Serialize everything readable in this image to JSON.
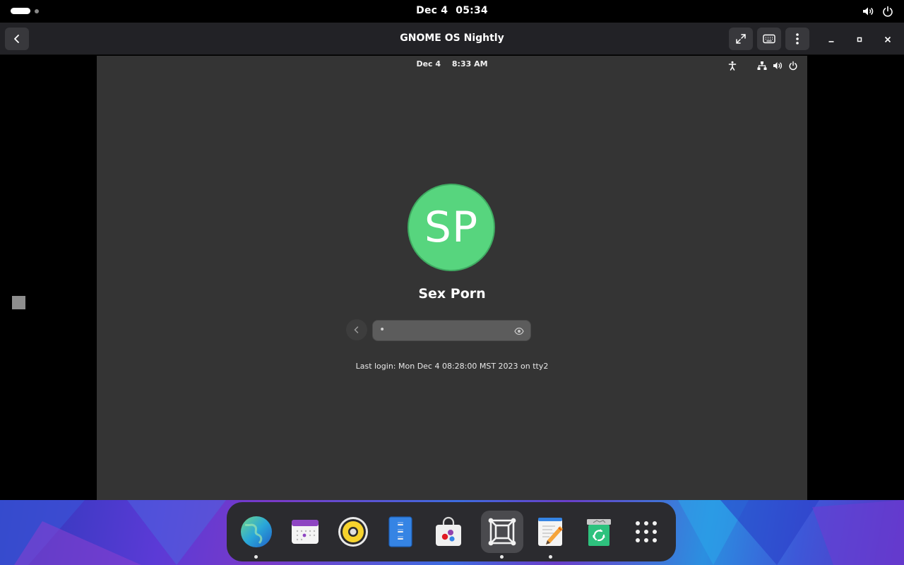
{
  "host": {
    "date": "Dec 4",
    "time": "05:34"
  },
  "window": {
    "title": "GNOME OS Nightly"
  },
  "vm": {
    "date": "Dec 4",
    "time": "8:33 AM",
    "avatar_initials": "SP",
    "avatar_color": "#57d57e",
    "user_name": "Sex Porn",
    "password_masked": "•",
    "last_login": "Last login: Mon Dec  4 08:28:00 MST 2023 on tty2"
  },
  "dock": {
    "items": [
      {
        "name": "web-browser",
        "icon": "globe-icon",
        "running": true
      },
      {
        "name": "calendar",
        "icon": "calendar-icon",
        "running": false
      },
      {
        "name": "rhythmbox",
        "icon": "speaker-icon",
        "running": false
      },
      {
        "name": "files",
        "icon": "file-cabinet-icon",
        "running": false
      },
      {
        "name": "software",
        "icon": "shopping-bag-icon",
        "running": false
      },
      {
        "name": "boxes",
        "icon": "boxes-icon",
        "running": true,
        "active": true
      },
      {
        "name": "text-editor",
        "icon": "text-editor-icon",
        "running": true
      },
      {
        "name": "trash",
        "icon": "recycle-icon",
        "running": false
      },
      {
        "name": "app-grid",
        "icon": "app-grid-icon",
        "running": false
      }
    ]
  }
}
